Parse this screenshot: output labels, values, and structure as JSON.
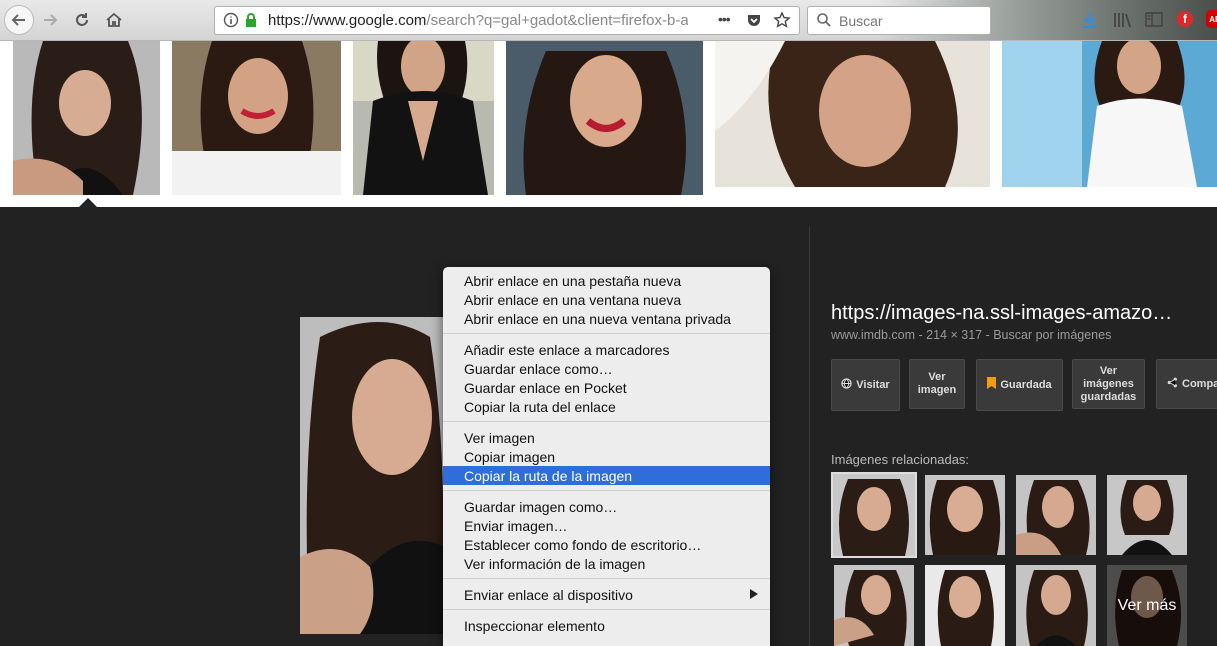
{
  "browser": {
    "url_host": "https://www.google.com",
    "url_rest": "/search?q=gal+gadot&client=firefox-b-a",
    "search_placeholder": "Buscar",
    "more_label": "•••"
  },
  "side": {
    "title": "https://images-na.ssl-images-amazo…",
    "meta": "www.imdb.com - 214 × 317 - Buscar por imágenes",
    "buttons": {
      "visit": "Visitar",
      "view_image": "Ver imagen",
      "saved": "Guardada",
      "view_saved": "Ver imágenes guardadas",
      "share": "Compa"
    },
    "related_label": "Imágenes relacionadas:",
    "more": "Ver más"
  },
  "menu": {
    "groups": [
      [
        "Abrir enlace en una pestaña nueva",
        "Abrir enlace en una ventana nueva",
        "Abrir enlace en una nueva ventana privada"
      ],
      [
        "Añadir este enlace a marcadores",
        "Guardar enlace como…",
        "Guardar enlace en Pocket",
        "Copiar la ruta del enlace"
      ],
      [
        "Ver imagen",
        "Copiar imagen",
        "Copiar la ruta de la imagen"
      ],
      [
        "Guardar imagen como…",
        "Enviar imagen…",
        "Establecer como fondo de escritorio…",
        "Ver información de la imagen"
      ],
      [
        "Enviar enlace al dispositivo"
      ],
      [
        "Inspeccionar elemento"
      ]
    ],
    "highlighted": "Copiar la ruta de la imagen"
  },
  "colors": {
    "highlight": "#2f6ed8",
    "panel": "#222222",
    "lock_green": "#2aa52a",
    "saved_orange": "#f29b14"
  },
  "icons": [
    "back-arrow-icon",
    "forward-arrow-icon",
    "reload-icon",
    "home-icon",
    "info-icon",
    "lock-icon",
    "pocket-icon",
    "star-icon",
    "search-icon",
    "download-icon",
    "library-icon",
    "sidebar-icon",
    "flipboard-icon",
    "adblock-icon",
    "globe-icon",
    "bookmark-icon",
    "share-icon",
    "submenu-arrow-icon"
  ]
}
